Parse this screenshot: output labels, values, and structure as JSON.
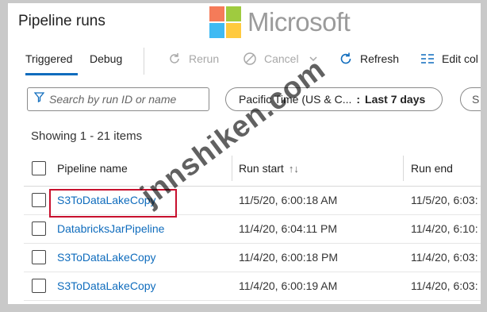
{
  "watermark": {
    "brand": "Microsoft",
    "site": "jnnshiken.com"
  },
  "page_title": "Pipeline runs",
  "tabs": [
    {
      "label": "Triggered",
      "active": true
    },
    {
      "label": "Debug",
      "active": false
    }
  ],
  "toolbar": {
    "rerun": "Rerun",
    "cancel": "Cancel",
    "refresh": "Refresh",
    "edit_columns": "Edit col"
  },
  "search": {
    "placeholder": "Search by run ID or name"
  },
  "filters": {
    "timezone": "Pacific Time (US & C...",
    "range": "Last 7 days",
    "more": "S"
  },
  "showing": "Showing 1 - 21 items",
  "table": {
    "headers": {
      "name": "Pipeline name",
      "start": "Run start",
      "end": "Run end"
    },
    "rows": [
      {
        "name": "S3ToDataLakeCopy",
        "start": "11/5/20, 6:00:18 AM",
        "end": "11/5/20, 6:03:"
      },
      {
        "name": "DatabricksJarPipeline",
        "start": "11/4/20, 6:04:11 PM",
        "end": "11/4/20, 6:10:"
      },
      {
        "name": "S3ToDataLakeCopy",
        "start": "11/4/20, 6:00:18 PM",
        "end": "11/4/20, 6:03:"
      },
      {
        "name": "S3ToDataLakeCopy",
        "start": "11/4/20, 6:00:19 AM",
        "end": "11/4/20, 6:03:"
      }
    ]
  },
  "colors": {
    "accent": "#0f6cbd",
    "highlight": "#c8102e"
  }
}
